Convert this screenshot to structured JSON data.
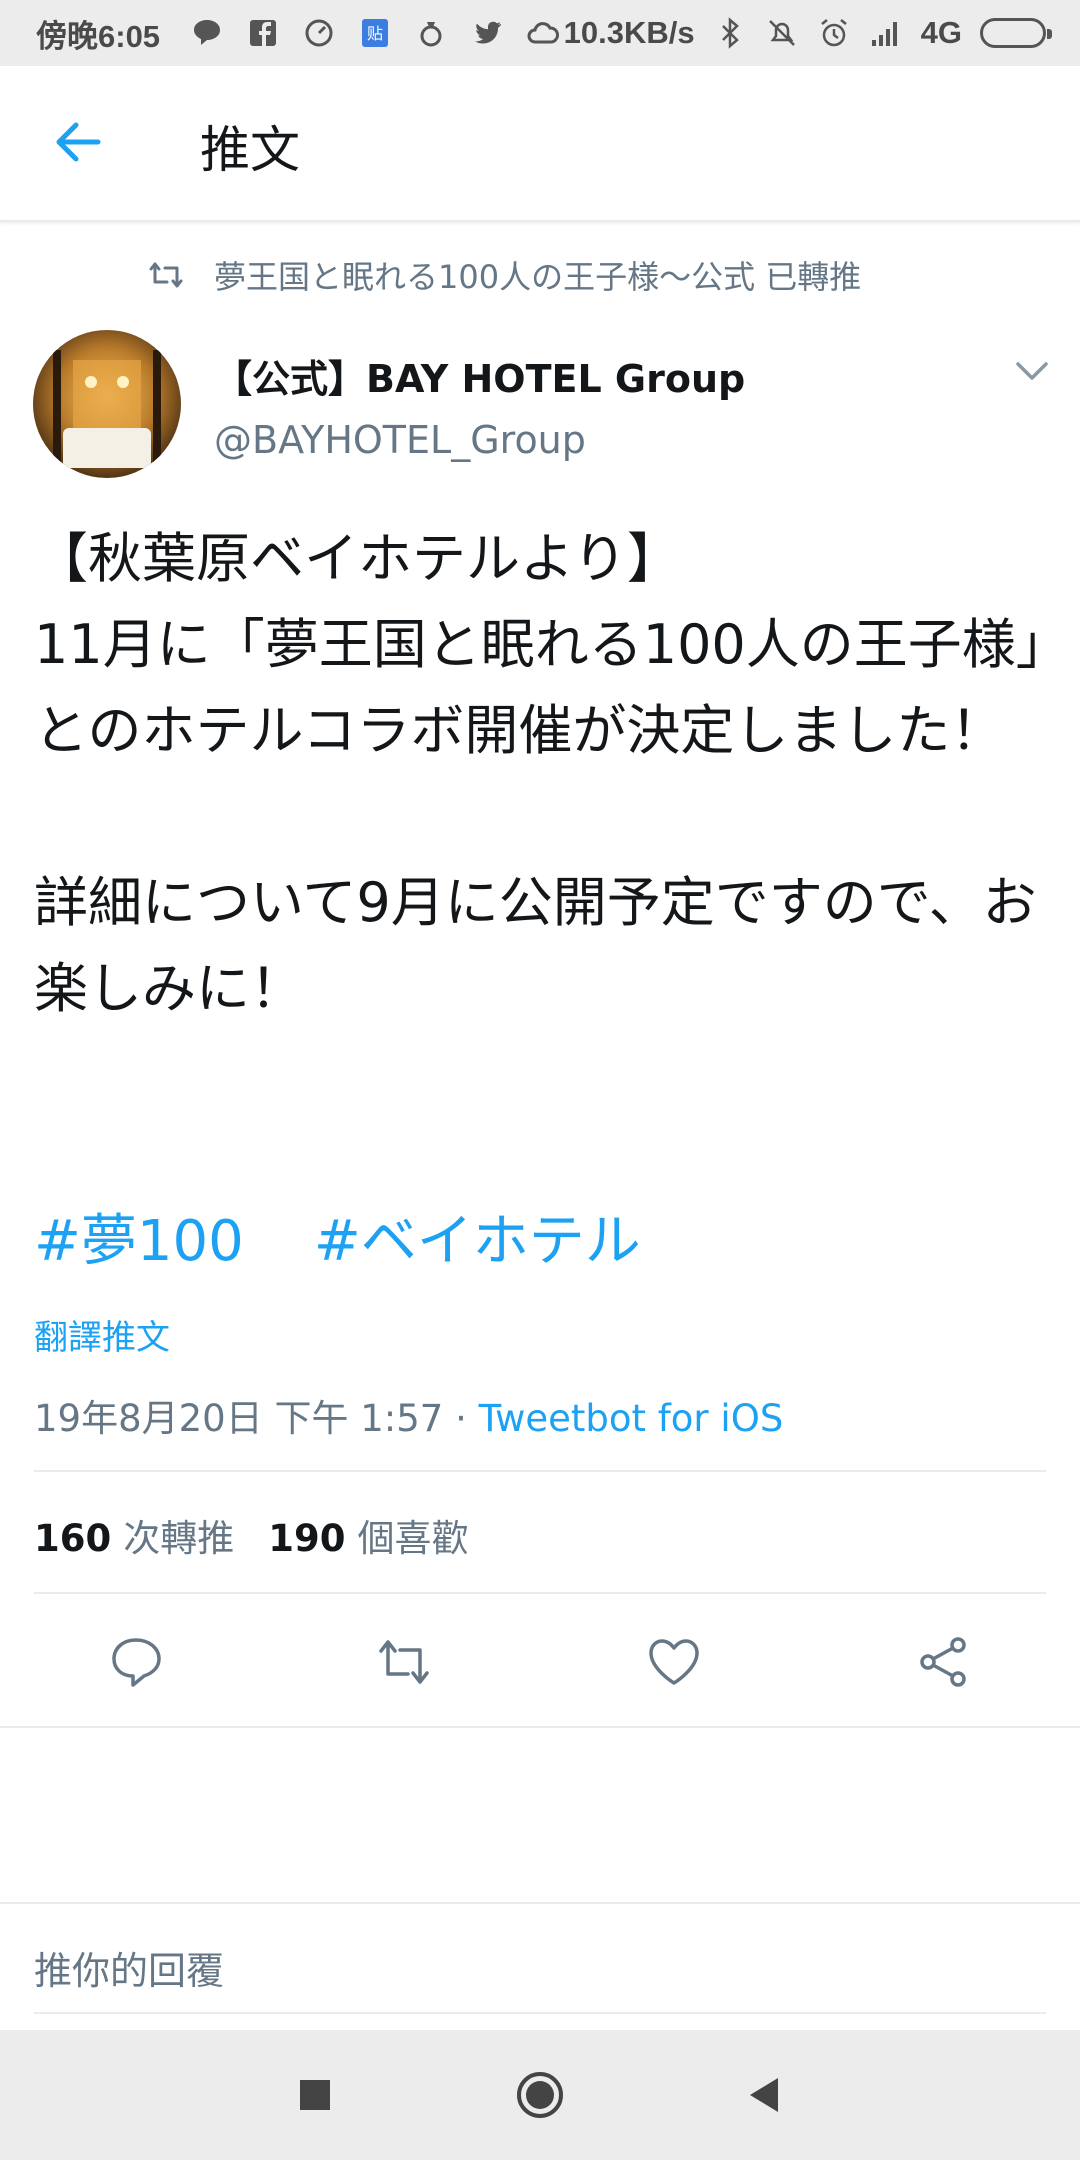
{
  "status_bar": {
    "time": "傍晚6:05",
    "speed": "10.3KB/s",
    "network": "4G",
    "icons_left": [
      "line-icon",
      "facebook-icon",
      "speedometer-icon",
      "tie-icon",
      "ring-icon",
      "twitter-icon",
      "cloud-icon"
    ],
    "icons_right": [
      "bluetooth-icon",
      "mute-icon",
      "alarm-icon",
      "signal-icon",
      "battery-charging-icon"
    ]
  },
  "header": {
    "title": "推文"
  },
  "retweet_context": {
    "text": "夢王国と眠れる100人の王子様～公式 已轉推"
  },
  "author": {
    "name": "【公式】BAY HOTEL Group",
    "handle": "@BAYHOTEL_Group"
  },
  "tweet": {
    "body": "【秋葉原ベイホテルより】\n11月に「夢王国と眠れる100人の王子様」とのホテルコラボ開催が決定しました！\n\n詳細について9月に公開予定ですので、お楽しみに！",
    "hashtags": [
      "#夢100",
      "#ベイホテル"
    ],
    "translate_label": "翻譯推文",
    "timestamp": "19年8月20日 下午 1:57",
    "separator": " · ",
    "source": "Tweetbot for iOS"
  },
  "stats": {
    "retweets_count": "160",
    "retweets_label": "次轉推",
    "likes_count": "190",
    "likes_label": "個喜歡"
  },
  "reply": {
    "placeholder": "推你的回覆"
  },
  "colors": {
    "accent": "#1da1f2",
    "secondary_text": "#657786",
    "divider": "#e6ecf0"
  }
}
